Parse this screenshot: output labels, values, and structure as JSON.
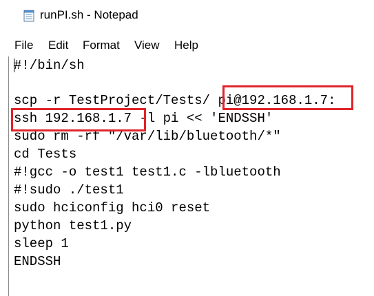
{
  "window": {
    "title": "runPI.sh - Notepad",
    "icon": "notepad-icon"
  },
  "menu": {
    "file": "File",
    "edit": "Edit",
    "format": "Format",
    "view": "View",
    "help": "Help"
  },
  "editor": {
    "lines": [
      "#!/bin/sh",
      "",
      "scp -r TestProject/Tests/ pi@192.168.1.7:",
      "ssh 192.168.1.7 -l pi << 'ENDSSH'",
      "sudo rm -rf \"/var/lib/bluetooth/*\"",
      "cd Tests",
      "#!gcc -o test1 test1.c -lbluetooth",
      "#!sudo ./test1",
      "sudo hciconfig hci0 reset",
      "python test1.py",
      "sleep 1",
      "ENDSSH"
    ]
  },
  "annotations": {
    "highlight_color": "#e0242a",
    "highlighted_texts": [
      "pi@192.168.1.7:",
      "ssh 192.168.1.7"
    ]
  }
}
